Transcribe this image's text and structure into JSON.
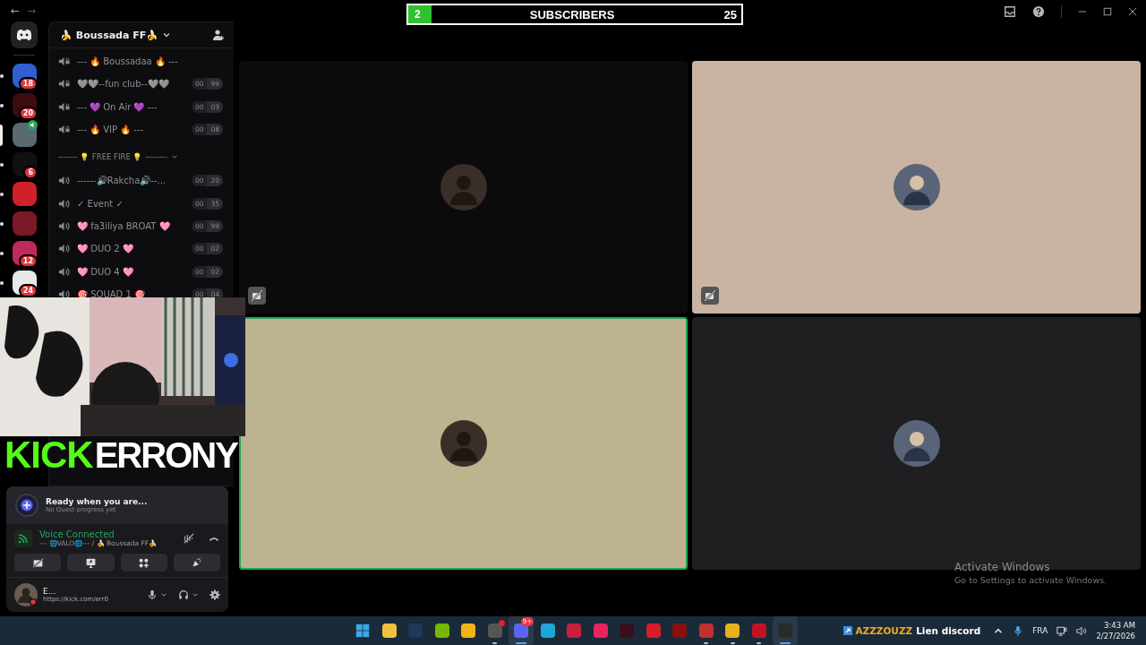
{
  "nav": {
    "back": "←",
    "forward": "→"
  },
  "servers": [
    {
      "color": "#2f5fd0",
      "badge": "18",
      "selected": false,
      "voice_active": false
    },
    {
      "color": "#3a0c10",
      "badge": "20",
      "selected": false,
      "voice_active": false
    },
    {
      "color": "#5a6a70",
      "selected": true,
      "voice_active": true
    },
    {
      "color": "#101010",
      "badge": "6",
      "selected": false,
      "voice_active": false
    },
    {
      "color": "#d0202a",
      "selected": false,
      "voice_active": false
    },
    {
      "color": "#7a1a24",
      "selected": false,
      "voice_active": false
    },
    {
      "color": "#c02a5a",
      "badge": "12",
      "selected": false,
      "voice_active": false
    },
    {
      "color": "#e8e8e8",
      "badge": "24",
      "selected": false,
      "voice_active": false
    }
  ],
  "channel_panel": {
    "server_name": "🍌 Boussada FF🍌",
    "items": [
      {
        "kind": "channel",
        "name": "--- 🔥 Boussadaa 🔥 ---",
        "locked": true
      },
      {
        "kind": "channel",
        "name": "🩶🩶--fun club--🩶🩶",
        "locked": true,
        "count": "00",
        "limit": "99"
      },
      {
        "kind": "channel",
        "name": "--- 💜 On Air 💜 ---",
        "locked": true,
        "count": "00",
        "limit": "03"
      },
      {
        "kind": "channel",
        "name": "--- 🔥 VIP 🔥 ---",
        "locked": true,
        "count": "00",
        "limit": "08"
      },
      {
        "kind": "category",
        "name": "------- 💡 FREE FIRE 💡 --------",
        "expanded": true
      },
      {
        "kind": "channel",
        "name": "------🔊Rakcha🔊--...",
        "locked": false,
        "count": "00",
        "limit": "20"
      },
      {
        "kind": "channel",
        "name": "✓ Event ✓",
        "locked": false,
        "count": "00",
        "limit": "35"
      },
      {
        "kind": "channel",
        "name": "🩷 fa3iliya BROAT 🩷",
        "locked": false,
        "count": "00",
        "limit": "99"
      },
      {
        "kind": "channel",
        "name": "🩷 DUO 2 🩷",
        "locked": false,
        "count": "00",
        "limit": "02"
      },
      {
        "kind": "channel",
        "name": "🩷 DUO 4 🩷",
        "locked": false,
        "count": "00",
        "limit": "02"
      },
      {
        "kind": "channel",
        "name": "🎯 SQUAD 1 🎯",
        "locked": false,
        "count": "00",
        "limit": "04"
      }
    ]
  },
  "quest": {
    "title": "Ready when you are...",
    "subtitle": "No Quest progress yet"
  },
  "voice": {
    "status": "Voice Connected",
    "channel": "--- 🌐VALO🌐--- / 🍌 Boussada FF🍌"
  },
  "user": {
    "name": "E...",
    "status": "https://kick.com/err0"
  },
  "tiles": [
    {
      "color": "#0b0b0b",
      "speaking": false,
      "camera_off_icon": true
    },
    {
      "color": "#c9b3a2",
      "speaking": false,
      "camera_off_icon": true
    },
    {
      "color": "#bdb38e",
      "speaking": true,
      "camera_off_icon": false
    },
    {
      "color": "#1f1f22",
      "speaking": false,
      "camera_off_icon": false
    }
  ],
  "subscribers": {
    "current": "2",
    "label": "SUBSCRIBERS",
    "goal": "25",
    "level": 0.07
  },
  "stream_overlay": {
    "brand": "KICK",
    "name": "ERRONY"
  },
  "activation_notice": {
    "title": "Activate Windows",
    "body": "Go to Settings to activate Windows."
  },
  "taskbar": {
    "apps": [
      {
        "kind": "start",
        "color": "#3aa8e8",
        "running": false,
        "active": false,
        "dot": false
      },
      {
        "kind": "app",
        "color": "#f2c23c",
        "running": false,
        "active": false,
        "dot": false
      },
      {
        "kind": "app",
        "color": "#1b3a5c",
        "running": false,
        "active": false,
        "dot": false
      },
      {
        "kind": "app",
        "color": "#76b900",
        "running": false,
        "active": false,
        "dot": false
      },
      {
        "kind": "app",
        "color": "#f5b316",
        "running": false,
        "active": false,
        "dot": false
      },
      {
        "kind": "app",
        "color": "#555555",
        "running": true,
        "active": false,
        "dot": true
      },
      {
        "kind": "app",
        "color": "#5865f2",
        "running": true,
        "active": true,
        "dot": false,
        "badge": "9+"
      },
      {
        "kind": "app",
        "color": "#1fa6d8",
        "running": false,
        "active": false,
        "dot": false
      },
      {
        "kind": "app",
        "color": "#c8203c",
        "running": false,
        "active": false,
        "dot": false
      },
      {
        "kind": "app",
        "color": "#e8245e",
        "running": false,
        "active": false,
        "dot": false
      },
      {
        "kind": "app",
        "color": "#3a0e1a",
        "running": false,
        "active": false,
        "dot": false
      },
      {
        "kind": "app",
        "color": "#d81c2a",
        "running": false,
        "active": false,
        "dot": false
      },
      {
        "kind": "app",
        "color": "#8a1010",
        "running": false,
        "active": false,
        "dot": false
      },
      {
        "kind": "app",
        "color": "#c03030",
        "running": true,
        "active": false,
        "dot": false
      },
      {
        "kind": "app",
        "color": "#e6b020",
        "running": true,
        "active": false,
        "dot": false
      },
      {
        "kind": "app",
        "color": "#c01424",
        "running": true,
        "active": false,
        "dot": false
      },
      {
        "kind": "app",
        "color": "#2a2a2a",
        "running": true,
        "active": true,
        "dot": false
      }
    ],
    "promo_name": "AZZZOUZZ",
    "promo_text": "Lien discord",
    "language": "FRA",
    "time": "3:43 AM",
    "date": "2/27/2026"
  }
}
